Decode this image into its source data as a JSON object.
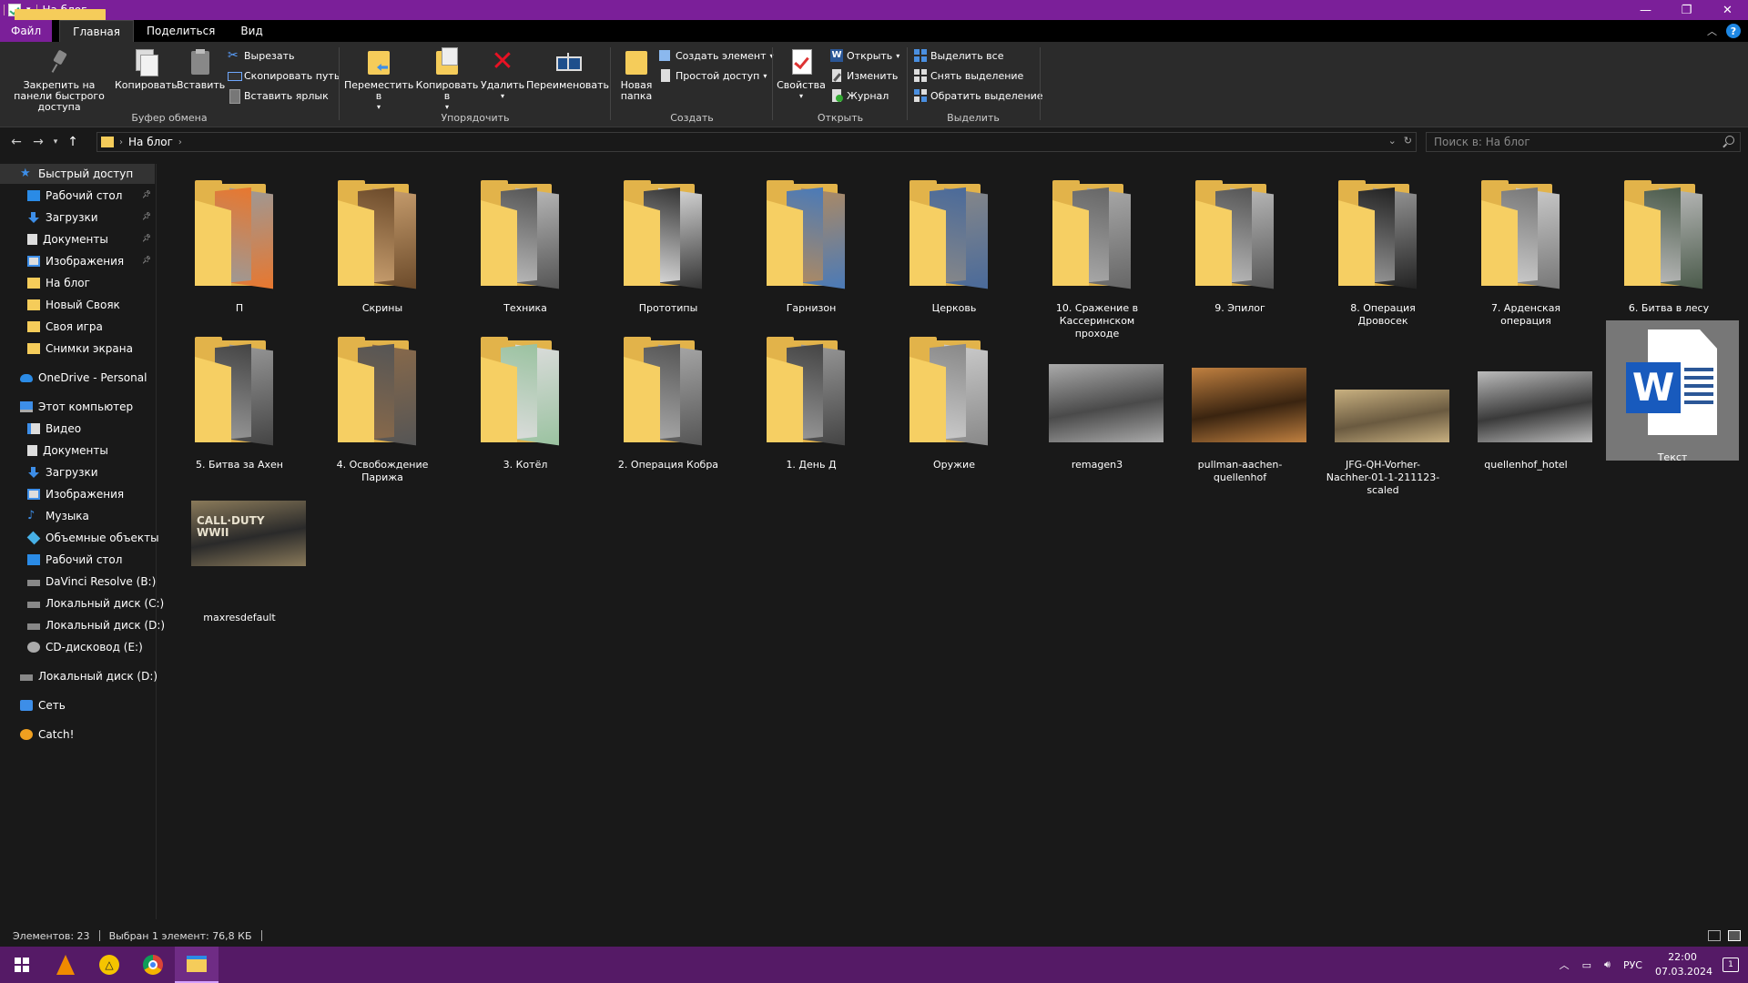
{
  "window": {
    "title": "На блог",
    "minimize": "—",
    "maximize": "❐",
    "close": "✕"
  },
  "tabs": {
    "file": "Файл",
    "home": "Главная",
    "share": "Поделиться",
    "view": "Вид",
    "help": "?"
  },
  "ribbon": {
    "clipboard": {
      "label": "Буфер обмена",
      "pin": "Закрепить на панели быстрого доступа",
      "copy": "Копировать",
      "paste": "Вставить",
      "cut": "Вырезать",
      "copy_path": "Скопировать путь",
      "paste_shortcut": "Вставить ярлык"
    },
    "organize": {
      "label": "Упорядочить",
      "move_to": "Переместить в",
      "copy_to": "Копировать в",
      "delete": "Удалить",
      "rename": "Переименовать"
    },
    "new": {
      "label": "Создать",
      "new_folder": "Новая папка",
      "new_item": "Создать элемент",
      "easy_access": "Простой доступ"
    },
    "open": {
      "label": "Открыть",
      "properties": "Свойства",
      "open": "Открыть",
      "edit": "Изменить",
      "history": "Журнал"
    },
    "select": {
      "label": "Выделить",
      "select_all": "Выделить все",
      "select_none": "Снять выделение",
      "invert": "Обратить выделение"
    }
  },
  "address": {
    "crumb": "На блог",
    "search_placeholder": "Поиск в: На блог"
  },
  "sidebar": {
    "items": [
      {
        "label": "Быстрый доступ",
        "icon": "star-icon"
      },
      {
        "label": "Рабочий стол",
        "icon": "desktop-icon"
      },
      {
        "label": "Загрузки",
        "icon": "download-icon"
      },
      {
        "label": "Документы",
        "icon": "document-icon"
      },
      {
        "label": "Изображения",
        "icon": "pictures-icon"
      },
      {
        "label": "На блог",
        "icon": "folder-icon"
      },
      {
        "label": "Новый Свояк",
        "icon": "folder-icon"
      },
      {
        "label": "Своя игра",
        "icon": "folder-icon"
      },
      {
        "label": "Снимки экрана",
        "icon": "folder-icon"
      },
      {
        "label": "OneDrive - Personal",
        "icon": "cloud-icon"
      },
      {
        "label": "Этот компьютер",
        "icon": "computer-icon"
      },
      {
        "label": "Видео",
        "icon": "video-icon"
      },
      {
        "label": "Документы",
        "icon": "document-icon"
      },
      {
        "label": "Загрузки",
        "icon": "download-icon"
      },
      {
        "label": "Изображения",
        "icon": "pictures-icon"
      },
      {
        "label": "Музыка",
        "icon": "music-icon"
      },
      {
        "label": "Объемные объекты",
        "icon": "3d-objects-icon"
      },
      {
        "label": "Рабочий стол",
        "icon": "desktop-icon"
      },
      {
        "label": "DaVinci Resolve (B:)",
        "icon": "drive-icon"
      },
      {
        "label": "Локальный диск (C:)",
        "icon": "drive-icon"
      },
      {
        "label": "Локальный диск (D:)",
        "icon": "drive-icon"
      },
      {
        "label": "CD-дисковод (E:)",
        "icon": "cd-drive-icon"
      },
      {
        "label": "Локальный диск (D:)",
        "icon": "drive-icon"
      },
      {
        "label": "Сеть",
        "icon": "network-icon"
      },
      {
        "label": "Catch!",
        "icon": "catch-icon"
      }
    ]
  },
  "files": [
    {
      "name": "П",
      "type": "folder",
      "c1": "#e8772e",
      "c2": "#9a9a9a"
    },
    {
      "name": "Скрины",
      "type": "folder",
      "c1": "#6b4a2a",
      "c2": "#caa070"
    },
    {
      "name": "Техника",
      "type": "folder",
      "c1": "#555555",
      "c2": "#bbbbbb"
    },
    {
      "name": "Прототипы",
      "type": "folder",
      "c1": "#333333",
      "c2": "#dddddd"
    },
    {
      "name": "Гарнизон",
      "type": "folder",
      "c1": "#4a7ab8",
      "c2": "#b08a60"
    },
    {
      "name": "Церковь",
      "type": "folder",
      "c1": "#4a6a9a",
      "c2": "#888888"
    },
    {
      "name": "10. Сражение в Кассеринском проходе",
      "type": "folder",
      "c1": "#666666",
      "c2": "#aaaaaa"
    },
    {
      "name": "9. Эпилог",
      "type": "folder",
      "c1": "#555555",
      "c2": "#bbbbbb"
    },
    {
      "name": "8. Операция Дровосек",
      "type": "folder",
      "c1": "#222222",
      "c2": "#999999"
    },
    {
      "name": "7. Арденская операция",
      "type": "folder",
      "c1": "#777777",
      "c2": "#cccccc"
    },
    {
      "name": "6. Битва в лесу",
      "type": "folder",
      "c1": "#4a5a4a",
      "c2": "#bbbbbb"
    },
    {
      "name": "5. Битва за Ахен",
      "type": "folder",
      "c1": "#444444",
      "c2": "#999999"
    },
    {
      "name": "4. Освобождение Парижа",
      "type": "folder",
      "c1": "#555555",
      "c2": "#8a6a4a"
    },
    {
      "name": "3. Котёл",
      "type": "folder",
      "c1": "#9ac2a0",
      "c2": "#dddddd"
    },
    {
      "name": "2. Операция Кобра",
      "type": "folder",
      "c1": "#555555",
      "c2": "#aaaaaa"
    },
    {
      "name": "1. День Д",
      "type": "folder",
      "c1": "#444444",
      "c2": "#999999"
    },
    {
      "name": "Оружие",
      "type": "folder",
      "c1": "#888888",
      "c2": "#cccccc"
    },
    {
      "name": "remagen3",
      "type": "image",
      "c1": "#4a4a4a",
      "c2": "#aaaaaa"
    },
    {
      "name": "pullman-aachen-quellenhof",
      "type": "image",
      "c1": "#3a2410",
      "c2": "#c08040"
    },
    {
      "name": "JFG-QH-Vorher-Nachher-01-1-211123-scaled",
      "type": "image",
      "c1": "#6a5a40",
      "c2": "#c8b080"
    },
    {
      "name": "quellenhof_hotel",
      "type": "image",
      "c1": "#3a3a3a",
      "c2": "#bbbbbb"
    },
    {
      "name": "Текст",
      "type": "word"
    },
    {
      "name": "maxresdefault",
      "type": "image",
      "c1": "#2a2a2a",
      "c2": "#8a7a5a",
      "caption": "CALL·DUTY WWII"
    }
  ],
  "status": {
    "count": "Элементов: 23",
    "selection": "Выбран 1 элемент: 76,8 КБ"
  },
  "tray": {
    "lang": "РУС",
    "time": "22:00",
    "date": "07.03.2024",
    "notifications": "1"
  }
}
